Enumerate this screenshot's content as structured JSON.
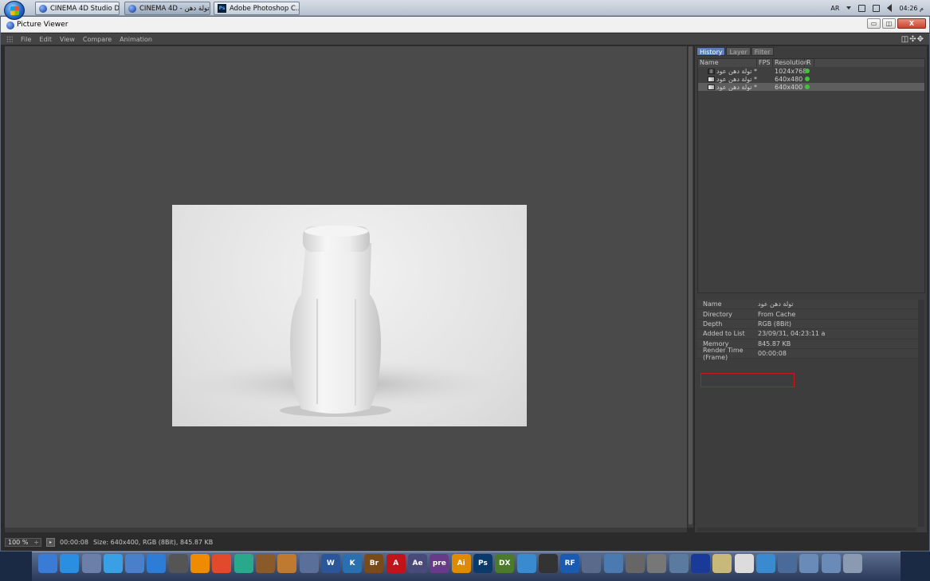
{
  "taskbar": {
    "buttons": [
      {
        "label": "CINEMA 4D Studio D...",
        "icon": "cinema4d-icon"
      },
      {
        "label": "CINEMA 4D - تولة دهن",
        "icon": "cinema4d-icon"
      },
      {
        "label": "Adobe Photoshop C...",
        "icon": "photoshop-icon"
      }
    ],
    "lang": "AR",
    "clock": "04:26 م"
  },
  "window": {
    "title": "Picture Viewer",
    "controls": {
      "minimize": "▭",
      "maximize": "◫",
      "close": "X"
    }
  },
  "menu": [
    "File",
    "Edit",
    "View",
    "Compare",
    "Animation"
  ],
  "panel": {
    "tabs": [
      "History",
      "Layer",
      "Filter"
    ],
    "columns": [
      "Name",
      "FPS",
      "Resolution",
      "R"
    ],
    "history": [
      {
        "name": "تولة دهن عود *",
        "fps": "",
        "resolution": "1024x768",
        "thumb": "dark"
      },
      {
        "name": "تولة دهن عود *",
        "fps": "",
        "resolution": "640x480",
        "thumb": "light"
      },
      {
        "name": "تولة دهن عود *",
        "fps": "",
        "resolution": "640x400",
        "thumb": "light"
      }
    ],
    "info": [
      {
        "key": "Name",
        "value": "تولة دهن عود"
      },
      {
        "key": "Directory",
        "value": "From Cache"
      },
      {
        "key": "Depth",
        "value": "RGB (8Bit)"
      },
      {
        "key": "Added to List",
        "value": "23/09/31, 04:23:11 a"
      },
      {
        "key": "Memory",
        "value": "845.87 KB"
      },
      {
        "key": "Render Time (Frame)",
        "value": "00:00:08"
      }
    ]
  },
  "status": {
    "zoom": "100 %",
    "time": "00:00:08",
    "info": "Size: 640x400, RGB (8Bit), 845.87 KB"
  },
  "dock": [
    {
      "label": "",
      "icon": "finder-icon",
      "color": "#3a7bd5"
    },
    {
      "label": "",
      "icon": "safari-icon",
      "color": "#2a8fe0"
    },
    {
      "label": "",
      "icon": "preview-icon",
      "color": "#6b7fa8"
    },
    {
      "label": "",
      "icon": "facetime-icon",
      "color": "#3aa0e6"
    },
    {
      "label": "",
      "icon": "imovie-icon",
      "color": "#4a7fc9"
    },
    {
      "label": "",
      "icon": "itunes-icon",
      "color": "#2d7cd6"
    },
    {
      "label": "",
      "icon": "dvd-icon",
      "color": "#555"
    },
    {
      "label": "",
      "icon": "vlc-icon",
      "color": "#f08a00"
    },
    {
      "label": "",
      "icon": "ccleaner-icon",
      "color": "#e14a2a"
    },
    {
      "label": "",
      "icon": "feather-icon",
      "color": "#2aa88c"
    },
    {
      "label": "",
      "icon": "wizard-icon",
      "color": "#8a5a2a"
    },
    {
      "label": "",
      "icon": "photo-icon",
      "color": "#c07a30"
    },
    {
      "label": "",
      "icon": "mail-icon",
      "color": "#5a6f99"
    },
    {
      "label": "W",
      "icon": "word-icon",
      "color": "#2b579a"
    },
    {
      "label": "K",
      "icon": "kinemaster-icon",
      "color": "#2a6fb0"
    },
    {
      "label": "Br",
      "icon": "bridge-icon",
      "color": "#7a4a18"
    },
    {
      "label": "A",
      "icon": "acrobat-icon",
      "color": "#c0141a"
    },
    {
      "label": "Ae",
      "icon": "aftereffects-icon",
      "color": "#4a4a7a"
    },
    {
      "label": "pre",
      "icon": "premiere-icon",
      "color": "#6a3a8a"
    },
    {
      "label": "Ai",
      "icon": "illustrator-icon",
      "color": "#e08a00"
    },
    {
      "label": "Ps",
      "icon": "photoshop-icon",
      "color": "#0a3a6a"
    },
    {
      "label": "DX",
      "icon": "dx-icon",
      "color": "#4a7a2a"
    },
    {
      "label": "",
      "icon": "cloud-icon",
      "color": "#3a8ad0"
    },
    {
      "label": "",
      "icon": "zbrush-icon",
      "color": "#333"
    },
    {
      "label": "RF",
      "icon": "realflow-icon",
      "color": "#1a5ab0"
    },
    {
      "label": "",
      "icon": "tools-icon",
      "color": "#5a6a8a"
    },
    {
      "label": "",
      "icon": "help-icon",
      "color": "#4a7ab0"
    },
    {
      "label": "",
      "icon": "settings-icon",
      "color": "#666"
    },
    {
      "label": "",
      "icon": "calculator-icon",
      "color": "#777"
    },
    {
      "label": "",
      "icon": "monitor-icon",
      "color": "#5a7aa0"
    },
    {
      "label": "",
      "icon": "cinema4d-icon",
      "color": "#1a3a9a"
    },
    {
      "label": "",
      "icon": "notes-icon",
      "color": "#c8b87a"
    },
    {
      "label": "",
      "icon": "document-icon",
      "color": "#dcdcdc"
    },
    {
      "label": "",
      "icon": "script-icon",
      "color": "#3a8ad0"
    },
    {
      "label": "",
      "icon": "server-icon",
      "color": "#4a6a9a"
    },
    {
      "label": "",
      "icon": "folder-icon",
      "color": "#6a8ab8"
    },
    {
      "label": "",
      "icon": "folder-icon",
      "color": "#6a8ab8"
    },
    {
      "label": "",
      "icon": "trash-icon",
      "color": "#8a9ab0"
    }
  ]
}
